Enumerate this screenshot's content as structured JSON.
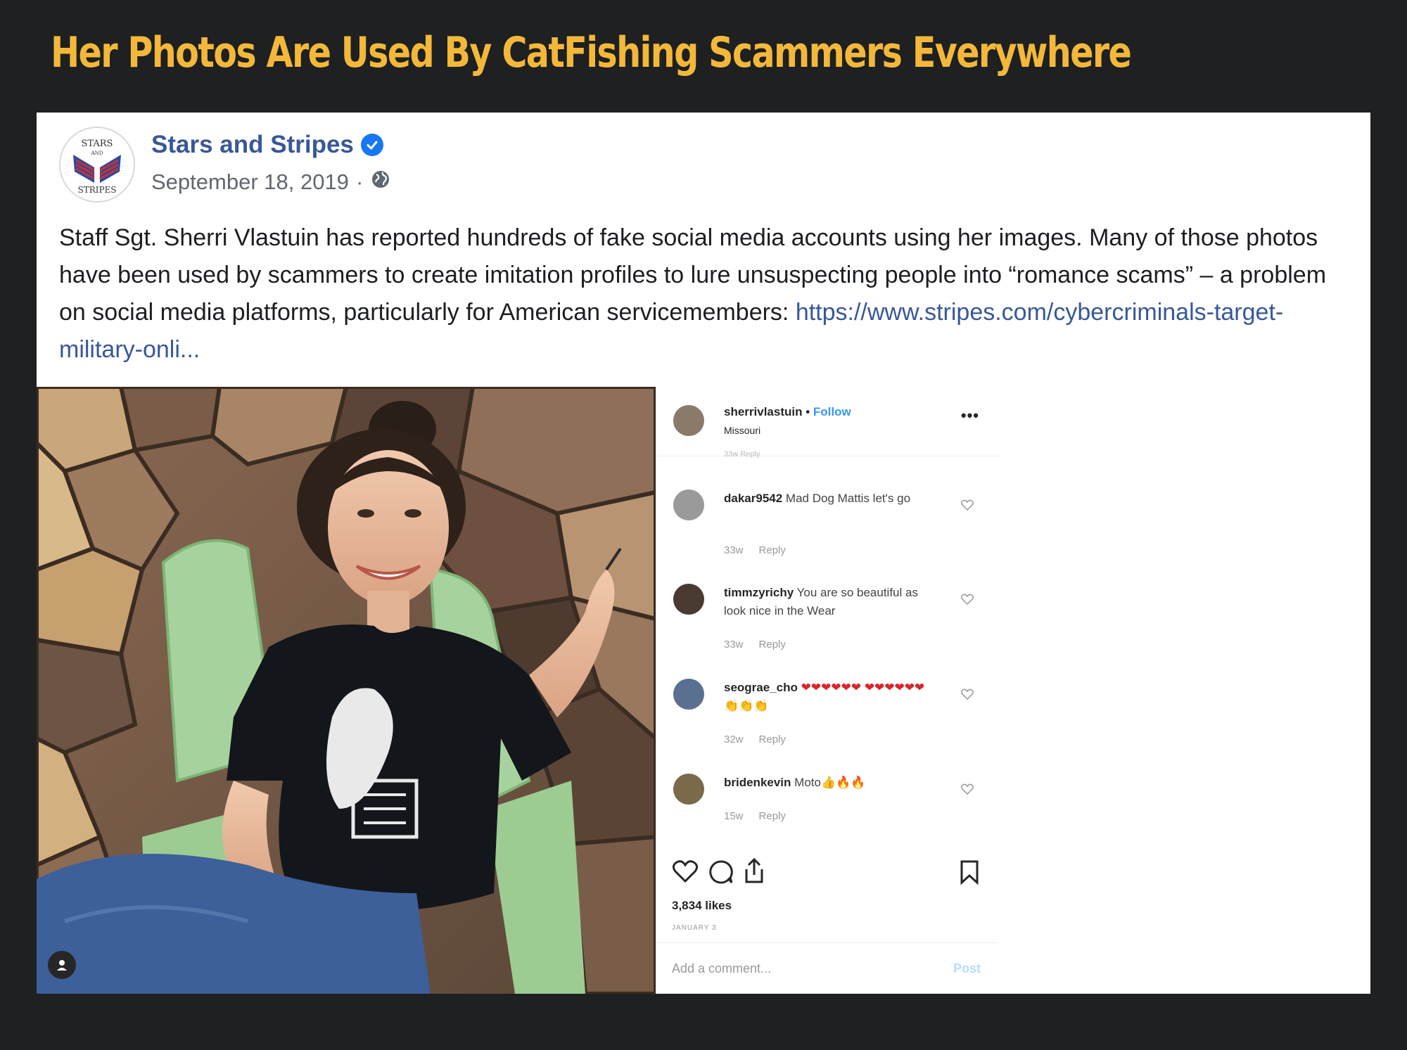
{
  "headline": "Her Photos Are Used By CatFishing Scammers Everywhere",
  "post": {
    "page_name": "Stars and Stripes",
    "date": "September 18, 2019",
    "separator": "·",
    "avatar_text": [
      "STARS",
      "AND",
      "STRIPES"
    ],
    "body_text": "Staff Sgt. Sherri Vlastuin has reported hundreds of fake social media accounts using her images. Many of those photos have been used by scammers to create imitation profiles to lure unsuspecting people into “romance scams” – a problem on social media platforms, particularly for American servicemembers: ",
    "link_text": "https://www.stripes.com/cybercriminals-target-military-onli..."
  },
  "instagram": {
    "username": "sherrivlastuin",
    "dot": " • ",
    "follow": "Follow",
    "location": "Missouri",
    "more": "•••",
    "clipped_meta": "33w Reply",
    "comments": [
      {
        "user": "dakar9542",
        "text": "Mad Dog Mattis let's go",
        "age": "33w",
        "reply": "Reply"
      },
      {
        "user": "timmzyrichy",
        "text": "You are so beautiful as look nice in the Wear",
        "age": "33w",
        "reply": "Reply"
      },
      {
        "user": "seograe_cho",
        "text": "❤❤❤❤❤❤ ❤❤❤❤❤❤👏👏👏",
        "age": "32w",
        "reply": "Reply"
      },
      {
        "user": "bridenkevin",
        "text": "Moto👍🔥🔥",
        "age": "15w",
        "reply": "Reply"
      }
    ],
    "likes": "3,834 likes",
    "post_date": "JANUARY 3",
    "add_comment_placeholder": "Add a comment...",
    "post_button": "Post"
  },
  "colors": {
    "background": "#1e2021",
    "headline": "#f3b83a",
    "link": "#385898",
    "verified": "#1877f2",
    "ig_follow": "#3897f0"
  }
}
